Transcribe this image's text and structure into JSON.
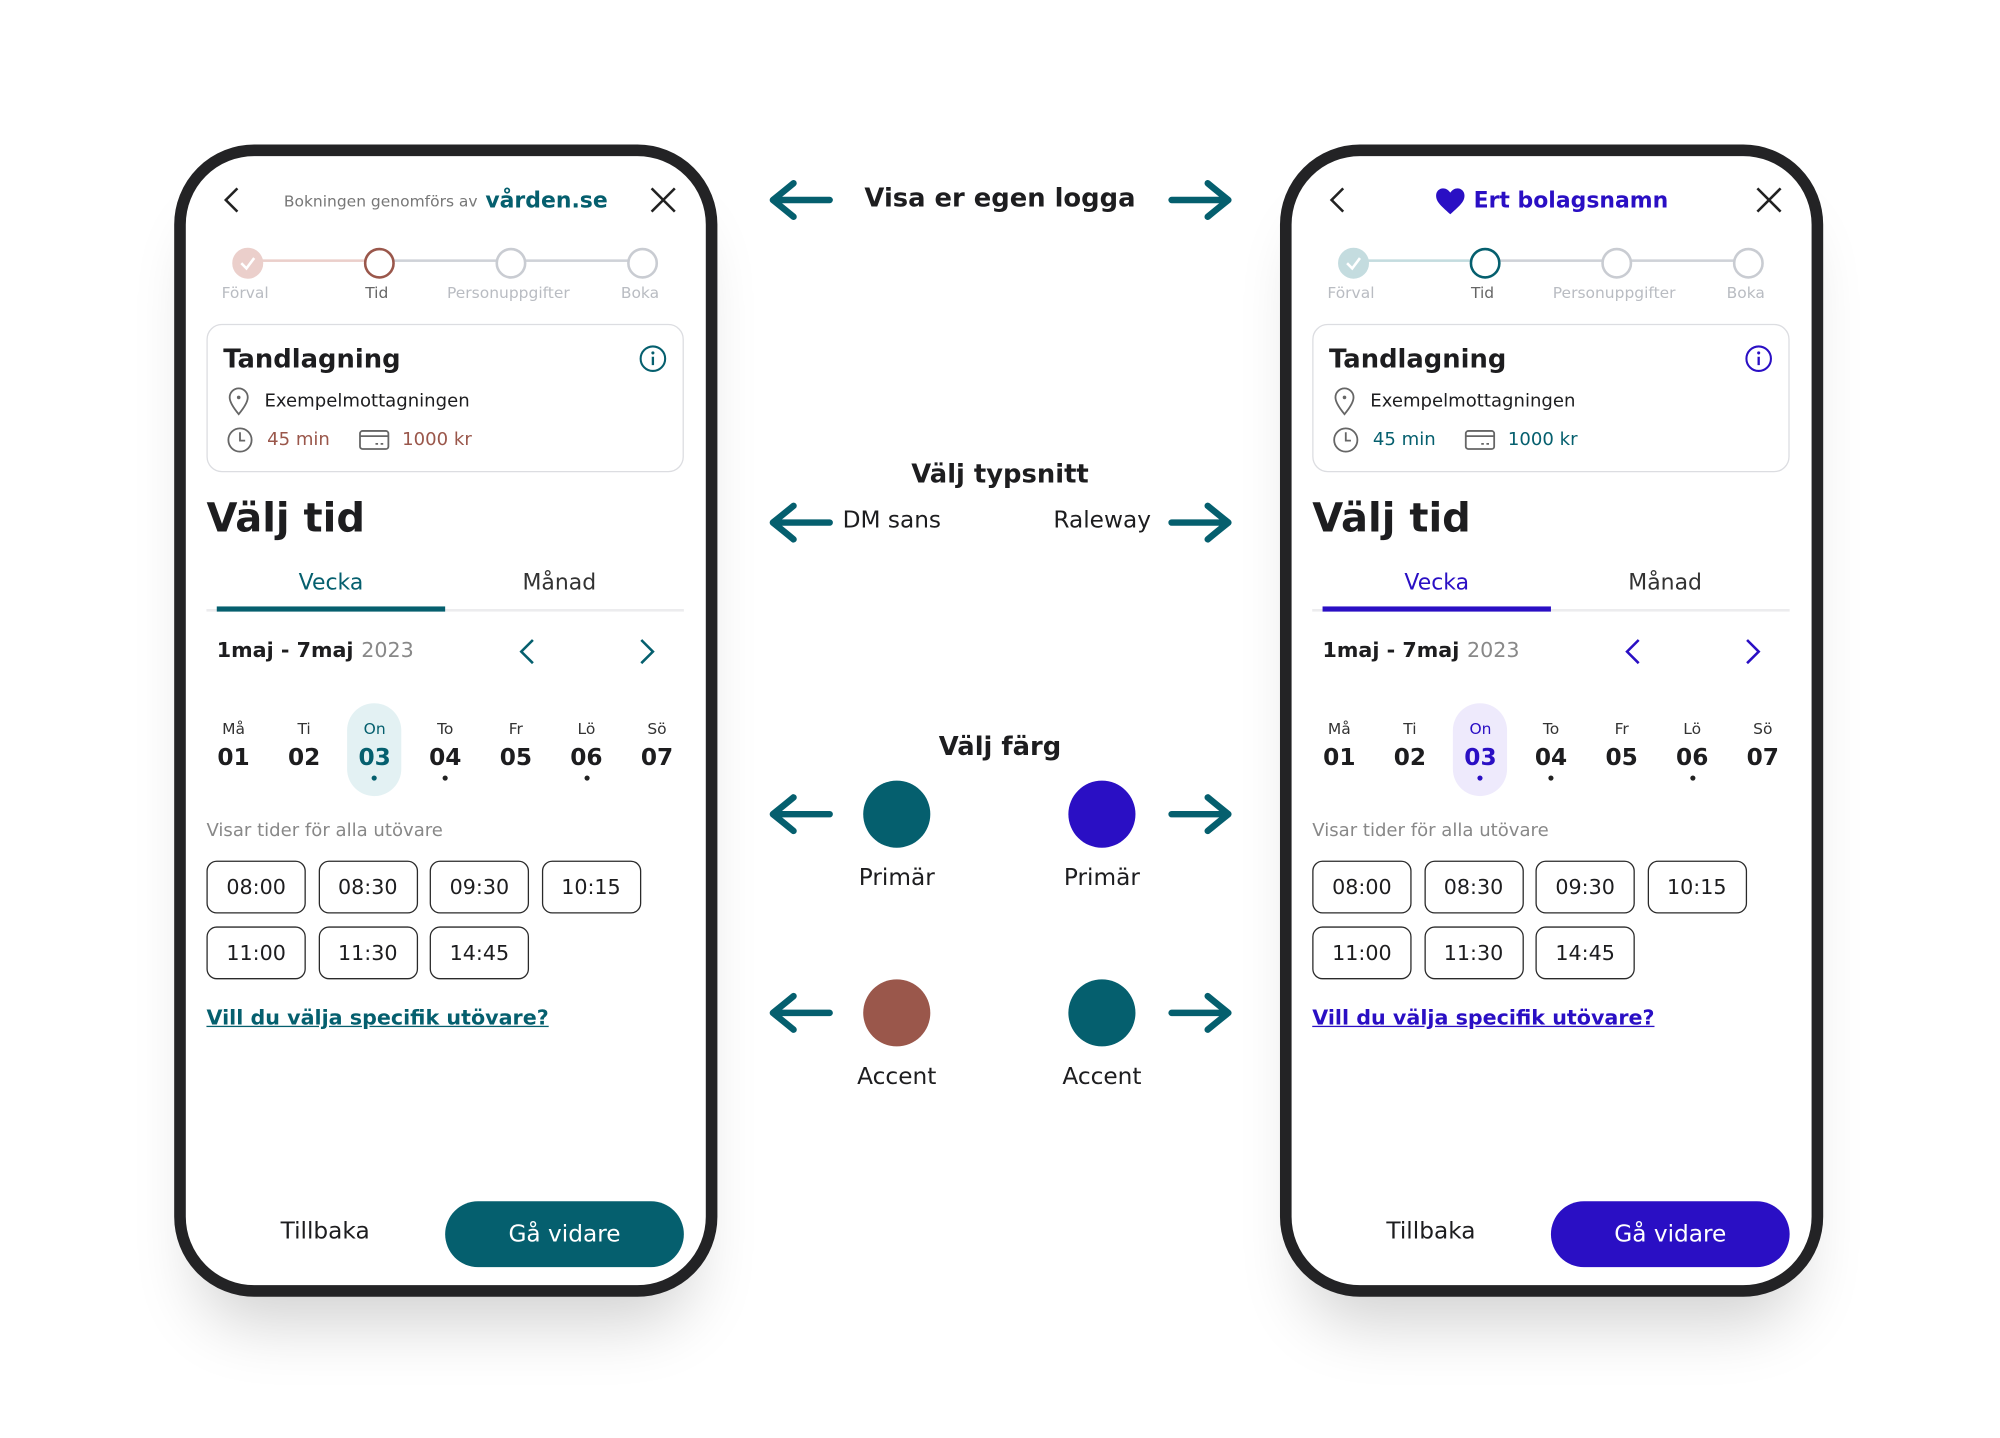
{
  "colors": {
    "teal": "#055f6e",
    "brown": "#9a574b",
    "purple": "#2a0fc4",
    "teal_light": "#e3f1f3",
    "purple_light": "#eeeafc",
    "teal_done": "#c4dcdf",
    "brown_done": "#ebcfcb"
  },
  "phones": [
    {
      "header": {
        "prefix": "Bokningen genomförs av",
        "logo": "vården.se",
        "brand": ""
      },
      "primary": "#055f6e",
      "accent": "#9a574b",
      "done": "#ebcfcb",
      "selected_bg": "#e3f1f3",
      "link_color": "#055f6e",
      "steps": [
        {
          "label": "Förval",
          "state": "done"
        },
        {
          "label": "Tid",
          "state": "current"
        },
        {
          "label": "Personuppgifter",
          "state": "todo"
        },
        {
          "label": "Boka",
          "state": "todo"
        }
      ],
      "card": {
        "title": "Tandlagning",
        "location": "Exempelmottagningen",
        "duration": "45 min",
        "price": "1000 kr"
      },
      "title": "Välj tid",
      "tabs": [
        {
          "label": "Vecka",
          "active": true
        },
        {
          "label": "Månad",
          "active": false
        }
      ],
      "range": {
        "label": "1maj - 7maj",
        "year": "2023"
      },
      "days": [
        {
          "label": "Må",
          "num": "01",
          "dot": false,
          "selected": false
        },
        {
          "label": "Ti",
          "num": "02",
          "dot": false,
          "selected": false
        },
        {
          "label": "On",
          "num": "03",
          "dot": true,
          "selected": true
        },
        {
          "label": "To",
          "num": "04",
          "dot": true,
          "selected": false
        },
        {
          "label": "Fr",
          "num": "05",
          "dot": false,
          "selected": false
        },
        {
          "label": "Lö",
          "num": "06",
          "dot": true,
          "selected": false
        },
        {
          "label": "Sö",
          "num": "07",
          "dot": false,
          "selected": false
        }
      ],
      "subtitle": "Visar tider för alla utövare",
      "slots": [
        "08:00",
        "08:30",
        "09:30",
        "10:15",
        "11:00",
        "11:30",
        "14:45"
      ],
      "link": "Vill du välja specifik utövare?",
      "back_label": "Tillbaka",
      "next_label": "Gå vidare"
    },
    {
      "header": {
        "prefix": "",
        "logo": "",
        "brand": "Ert bolagsnamn",
        "icon": "heart-icon"
      },
      "primary": "#2a0fc4",
      "accent": "#055f6e",
      "done": "#c4dcdf",
      "selected_bg": "#eeeafc",
      "link_color": "#2a0fc4",
      "steps": [
        {
          "label": "Förval",
          "state": "done"
        },
        {
          "label": "Tid",
          "state": "current"
        },
        {
          "label": "Personuppgifter",
          "state": "todo"
        },
        {
          "label": "Boka",
          "state": "todo"
        }
      ],
      "card": {
        "title": "Tandlagning",
        "location": "Exempelmottagningen",
        "duration": "45 min",
        "price": "1000 kr"
      },
      "title": "Välj tid",
      "tabs": [
        {
          "label": "Vecka",
          "active": true
        },
        {
          "label": "Månad",
          "active": false
        }
      ],
      "range": {
        "label": "1maj - 7maj",
        "year": "2023"
      },
      "days": [
        {
          "label": "Må",
          "num": "01",
          "dot": false,
          "selected": false
        },
        {
          "label": "Ti",
          "num": "02",
          "dot": false,
          "selected": false
        },
        {
          "label": "On",
          "num": "03",
          "dot": true,
          "selected": true
        },
        {
          "label": "To",
          "num": "04",
          "dot": true,
          "selected": false
        },
        {
          "label": "Fr",
          "num": "05",
          "dot": false,
          "selected": false
        },
        {
          "label": "Lö",
          "num": "06",
          "dot": true,
          "selected": false
        },
        {
          "label": "Sö",
          "num": "07",
          "dot": false,
          "selected": false
        }
      ],
      "subtitle": "Visar tider för alla utövare",
      "slots": [
        "08:00",
        "08:30",
        "09:30",
        "10:15",
        "11:00",
        "11:30",
        "14:45"
      ],
      "link": "Vill du välja specifik utövare?",
      "back_label": "Tillbaka",
      "next_label": "Gå vidare"
    }
  ],
  "middle": {
    "logo_heading": "Visa er egen logga",
    "font_heading": "Välj typsnitt",
    "font_left": "DM sans",
    "font_right": "Raleway",
    "color_heading": "Välj färg",
    "swatches": [
      {
        "label": "Primär",
        "color": "#055f6e"
      },
      {
        "label": "Primär",
        "color": "#2a0fc4"
      },
      {
        "label": "Accent",
        "color": "#9a574b"
      },
      {
        "label": "Accent",
        "color": "#055f6e"
      }
    ]
  }
}
